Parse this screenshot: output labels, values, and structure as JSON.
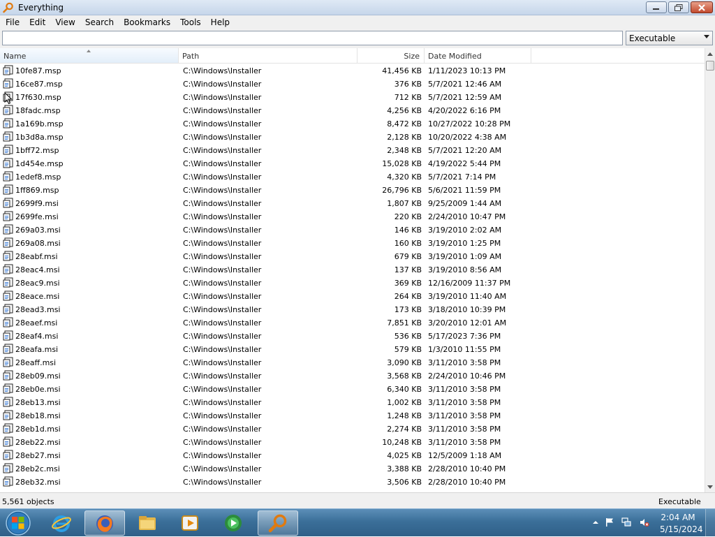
{
  "window": {
    "title": "Everything",
    "app_icon": "magnifier-icon",
    "controls": [
      "minimize-icon",
      "maximize-icon",
      "close-icon"
    ]
  },
  "menu": [
    "File",
    "Edit",
    "View",
    "Search",
    "Bookmarks",
    "Tools",
    "Help"
  ],
  "search": {
    "value": "",
    "placeholder": ""
  },
  "filter": {
    "selected": "Executable"
  },
  "columns": {
    "name": "Name",
    "path": "Path",
    "size": "Size",
    "date": "Date Modified",
    "sorted_by": "Name",
    "sort_direction": "ascending"
  },
  "files": [
    {
      "name": "10fe87.msp",
      "path": "C:\\Windows\\Installer",
      "size": "41,456 KB",
      "date": "1/11/2023 10:13 PM"
    },
    {
      "name": "16ce87.msp",
      "path": "C:\\Windows\\Installer",
      "size": "376 KB",
      "date": "5/7/2021 12:46 AM"
    },
    {
      "name": "17f630.msp",
      "path": "C:\\Windows\\Installer",
      "size": "712 KB",
      "date": "5/7/2021 12:59 AM"
    },
    {
      "name": "18fadc.msp",
      "path": "C:\\Windows\\Installer",
      "size": "4,256 KB",
      "date": "4/20/2022 6:16 PM"
    },
    {
      "name": "1a169b.msp",
      "path": "C:\\Windows\\Installer",
      "size": "8,472 KB",
      "date": "10/27/2022 10:28 PM"
    },
    {
      "name": "1b3d8a.msp",
      "path": "C:\\Windows\\Installer",
      "size": "2,128 KB",
      "date": "10/20/2022 4:38 AM"
    },
    {
      "name": "1bff72.msp",
      "path": "C:\\Windows\\Installer",
      "size": "2,348 KB",
      "date": "5/7/2021 12:20 AM"
    },
    {
      "name": "1d454e.msp",
      "path": "C:\\Windows\\Installer",
      "size": "15,028 KB",
      "date": "4/19/2022 5:44 PM"
    },
    {
      "name": "1edef8.msp",
      "path": "C:\\Windows\\Installer",
      "size": "4,320 KB",
      "date": "5/7/2021 7:14 PM"
    },
    {
      "name": "1ff869.msp",
      "path": "C:\\Windows\\Installer",
      "size": "26,796 KB",
      "date": "5/6/2021 11:59 PM"
    },
    {
      "name": "2699f9.msi",
      "path": "C:\\Windows\\Installer",
      "size": "1,807 KB",
      "date": "9/25/2009 1:44 AM"
    },
    {
      "name": "2699fe.msi",
      "path": "C:\\Windows\\Installer",
      "size": "220 KB",
      "date": "2/24/2010 10:47 PM"
    },
    {
      "name": "269a03.msi",
      "path": "C:\\Windows\\Installer",
      "size": "146 KB",
      "date": "3/19/2010 2:02 AM"
    },
    {
      "name": "269a08.msi",
      "path": "C:\\Windows\\Installer",
      "size": "160 KB",
      "date": "3/19/2010 1:25 PM"
    },
    {
      "name": "28eabf.msi",
      "path": "C:\\Windows\\Installer",
      "size": "679 KB",
      "date": "3/19/2010 1:09 AM"
    },
    {
      "name": "28eac4.msi",
      "path": "C:\\Windows\\Installer",
      "size": "137 KB",
      "date": "3/19/2010 8:56 AM"
    },
    {
      "name": "28eac9.msi",
      "path": "C:\\Windows\\Installer",
      "size": "369 KB",
      "date": "12/16/2009 11:37 PM"
    },
    {
      "name": "28eace.msi",
      "path": "C:\\Windows\\Installer",
      "size": "264 KB",
      "date": "3/19/2010 11:40 AM"
    },
    {
      "name": "28ead3.msi",
      "path": "C:\\Windows\\Installer",
      "size": "173 KB",
      "date": "3/18/2010 10:39 PM"
    },
    {
      "name": "28eaef.msi",
      "path": "C:\\Windows\\Installer",
      "size": "7,851 KB",
      "date": "3/20/2010 12:01 AM"
    },
    {
      "name": "28eaf4.msi",
      "path": "C:\\Windows\\Installer",
      "size": "536 KB",
      "date": "5/17/2023 7:36 PM"
    },
    {
      "name": "28eafa.msi",
      "path": "C:\\Windows\\Installer",
      "size": "579 KB",
      "date": "1/3/2010 11:55 PM"
    },
    {
      "name": "28eaff.msi",
      "path": "C:\\Windows\\Installer",
      "size": "3,090 KB",
      "date": "3/11/2010 3:58 PM"
    },
    {
      "name": "28eb09.msi",
      "path": "C:\\Windows\\Installer",
      "size": "3,568 KB",
      "date": "2/24/2010 10:46 PM"
    },
    {
      "name": "28eb0e.msi",
      "path": "C:\\Windows\\Installer",
      "size": "6,340 KB",
      "date": "3/11/2010 3:58 PM"
    },
    {
      "name": "28eb13.msi",
      "path": "C:\\Windows\\Installer",
      "size": "1,002 KB",
      "date": "3/11/2010 3:58 PM"
    },
    {
      "name": "28eb18.msi",
      "path": "C:\\Windows\\Installer",
      "size": "1,248 KB",
      "date": "3/11/2010 3:58 PM"
    },
    {
      "name": "28eb1d.msi",
      "path": "C:\\Windows\\Installer",
      "size": "2,274 KB",
      "date": "3/11/2010 3:58 PM"
    },
    {
      "name": "28eb22.msi",
      "path": "C:\\Windows\\Installer",
      "size": "10,248 KB",
      "date": "3/11/2010 3:58 PM"
    },
    {
      "name": "28eb27.msi",
      "path": "C:\\Windows\\Installer",
      "size": "4,025 KB",
      "date": "12/5/2009 1:18 AM"
    },
    {
      "name": "28eb2c.msi",
      "path": "C:\\Windows\\Installer",
      "size": "3,388 KB",
      "date": "2/28/2010 10:40 PM"
    },
    {
      "name": "28eb32.msi",
      "path": "C:\\Windows\\Installer",
      "size": "3,506 KB",
      "date": "2/28/2010 10:40 PM"
    }
  ],
  "status": {
    "count": "5,561 objects",
    "filter": "Executable"
  },
  "taskbar": {
    "apps": [
      "start-orb-icon",
      "internet-explorer-icon",
      "firefox-icon",
      "file-explorer-icon",
      "media-player-icon",
      "media-center-icon",
      "everything-search-icon"
    ],
    "active_app": "everything-search-icon",
    "tray_icons": [
      "show-hidden-icons-icon",
      "action-center-flag-icon",
      "network-icon",
      "volume-muted-icon"
    ],
    "clock_time": "2:04 AM",
    "clock_date": "5/15/2024"
  },
  "colors": {
    "title_bar": "#c6d6ea",
    "taskbar": "#3b6f99",
    "sorted_header": "#e3eef9",
    "close_button": "#c24a2e"
  }
}
